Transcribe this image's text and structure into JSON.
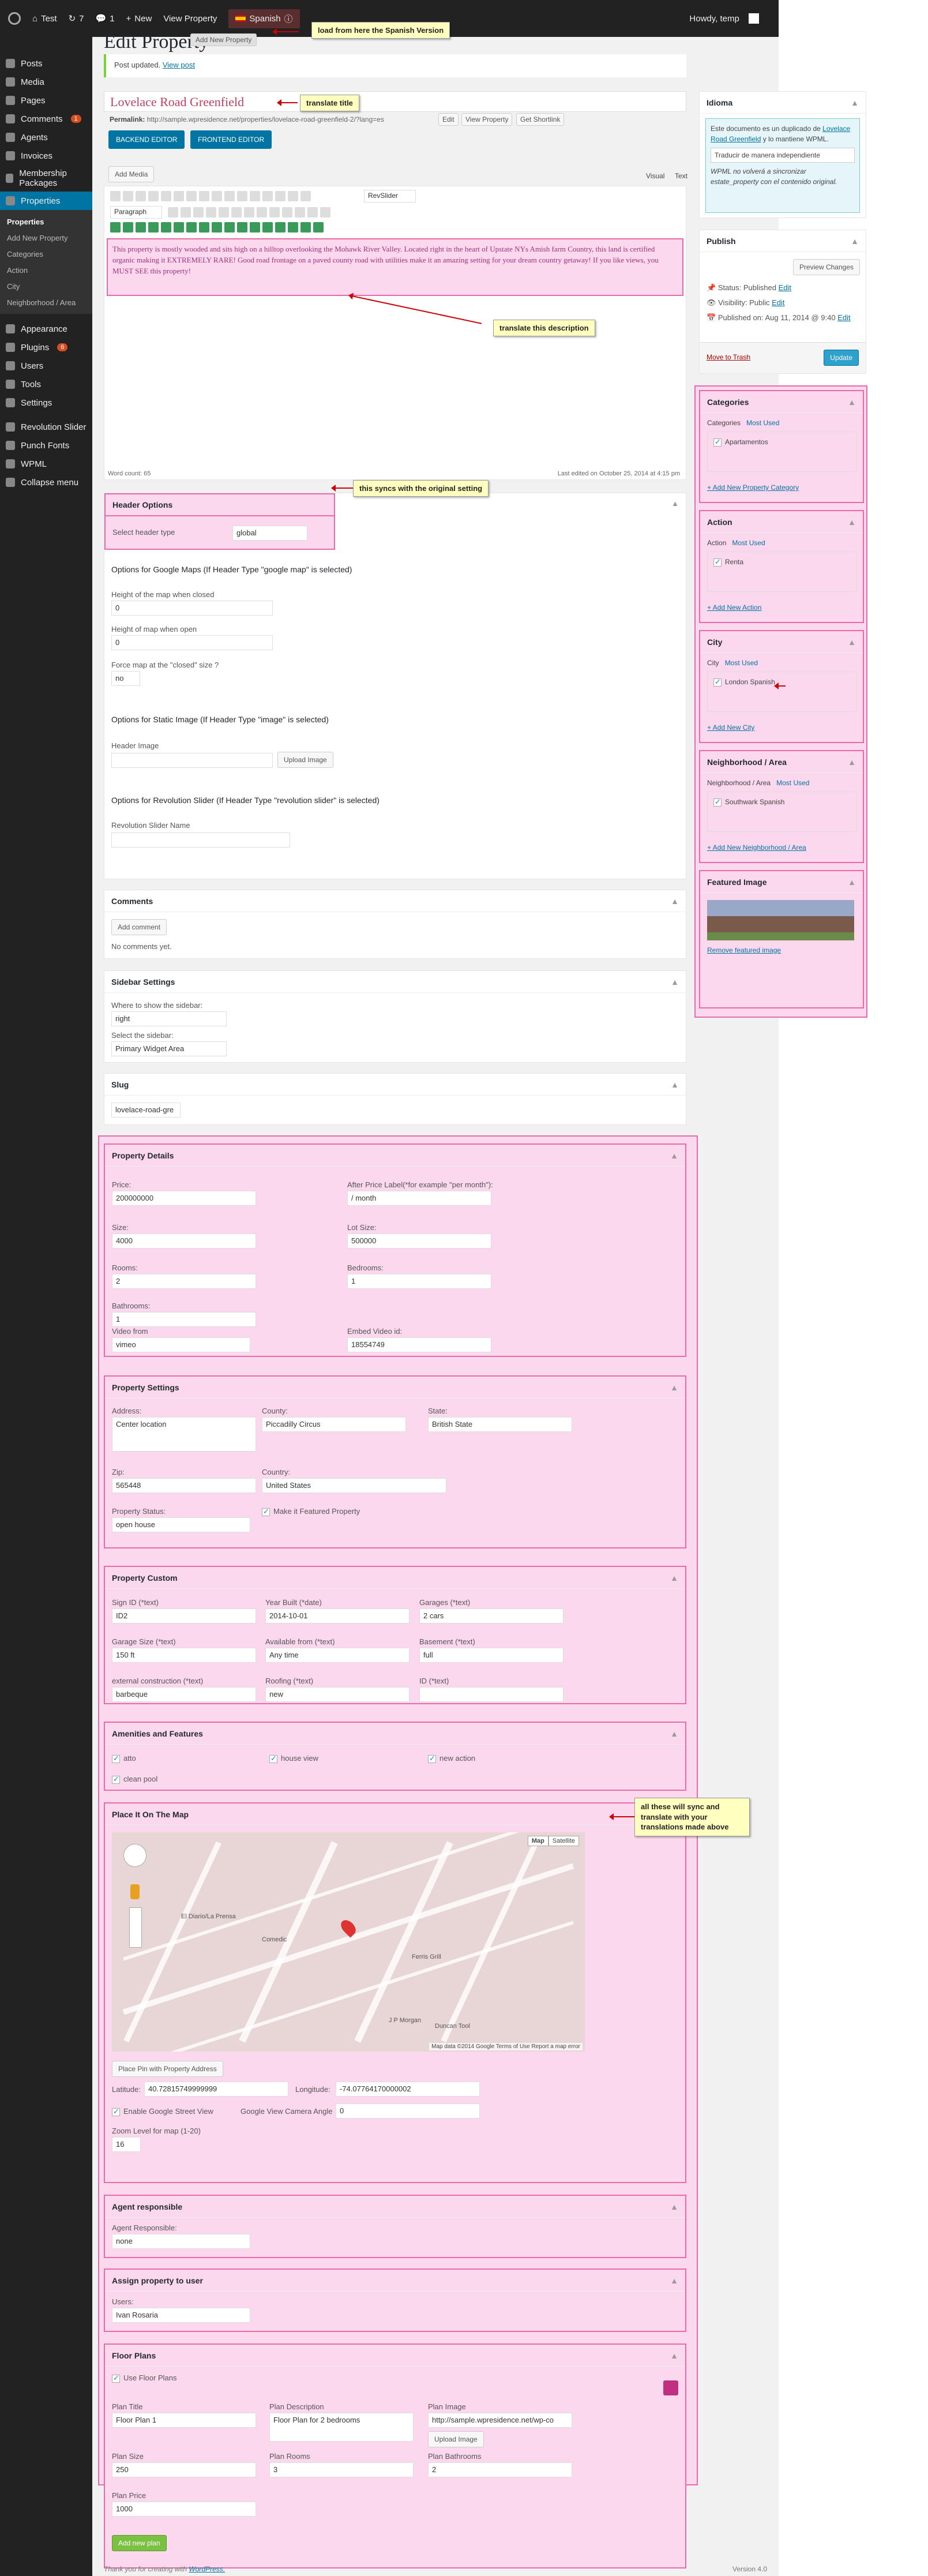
{
  "adminbar": {
    "site": "Test",
    "updates": "7",
    "comments": "1",
    "new": "New",
    "view": "View Property",
    "lang": "Spanish",
    "lang_flag": "spain-flag-icon",
    "howdy": "Howdy, temp"
  },
  "sidebar": {
    "items": [
      {
        "label": "Posts",
        "icon": "pin-icon"
      },
      {
        "label": "Media",
        "icon": "media-icon"
      },
      {
        "label": "Pages",
        "icon": "page-icon"
      },
      {
        "label": "Comments",
        "icon": "comment-icon",
        "badge": "1"
      },
      {
        "label": "Agents",
        "icon": "user-icon"
      },
      {
        "label": "Invoices",
        "icon": "invoice-icon"
      },
      {
        "label": "Membership Packages",
        "icon": "package-icon"
      },
      {
        "label": "Properties",
        "icon": "home-icon",
        "active": true
      }
    ],
    "sub": [
      "Properties",
      "Add New Property",
      "Categories",
      "Action",
      "City",
      "Neighborhood / Area"
    ],
    "items2": [
      {
        "label": "Appearance"
      },
      {
        "label": "Plugins",
        "badge": "6"
      },
      {
        "label": "Users"
      },
      {
        "label": "Tools"
      },
      {
        "label": "Settings"
      },
      {
        "label": "Revolution Slider"
      },
      {
        "label": "Punch Fonts"
      },
      {
        "label": "WPML"
      },
      {
        "label": "Collapse menu"
      }
    ]
  },
  "page": {
    "title": "Edit Property",
    "add_new": "Add New Property",
    "notice": "Post updated.",
    "notice_link": "View post"
  },
  "editor": {
    "post_title": "Lovelace Road Greenfield",
    "permalink_label": "Permalink:",
    "permalink": "http://sample.wpresidence.net/properties/lovelace-road-greenfield-2/?lang=es",
    "edit": "Edit",
    "view_property": "View Property",
    "get_shortlink": "Get Shortlink",
    "backend": "BACKEND EDITOR",
    "frontend": "FRONTEND EDITOR",
    "add_media": "Add Media",
    "visual": "Visual",
    "text": "Text",
    "paragraph": "Paragraph",
    "revslider": "RevSlider",
    "body": "This property is mostly wooded and sits high on a hilltop overlooking the Mohawk River Valley. Located right in the heart of Upstate NYs Amish farm Country, this land is certified organic making it EXTREMELY RARE! Good road frontage on a paved county road with utilities make it an amazing setting for your dream country getaway! If you like views, you MUST SEE this property!",
    "word_count": "Word count: 65",
    "last_edited": "Last edited on October 25, 2014 at 4:15 pm"
  },
  "header_options": {
    "title": "Header Options",
    "label": "Select header type",
    "value": "global"
  },
  "gmaps": {
    "title": "Options for Google Maps (If Header Type \"google map\" is selected)",
    "h_closed": "Height of the map when closed",
    "h_closed_val": "0",
    "h_open": "Height of map when open",
    "h_open_val": "0",
    "force": "Force map at the \"closed\" size ?",
    "force_val": "no"
  },
  "static_img": {
    "title": "Options for Static Image (If Header Type \"image\" is selected)",
    "label": "Header Image",
    "btn": "Upload Image"
  },
  "rev": {
    "title": "Options for Revolution Slider (If Header Type \"revolution slider\" is selected)",
    "label": "Revolution Slider Name"
  },
  "comments": {
    "title": "Comments",
    "btn": "Add comment",
    "none": "No comments yet."
  },
  "sidebar_settings": {
    "title": "Sidebar Settings",
    "where": "Where to show the sidebar:",
    "where_val": "right",
    "select": "Select the sidebar:",
    "select_val": "Primary Widget Area"
  },
  "slug": {
    "title": "Slug",
    "value": "lovelace-road-gre"
  },
  "details": {
    "title": "Property Details",
    "price": "Price:",
    "price_val": "200000000",
    "after": "After Price Label(*for example \"per month\"):",
    "after_val": "/ month",
    "size": "Size:",
    "size_val": "4000",
    "lot": "Lot Size:",
    "lot_val": "500000",
    "rooms": "Rooms:",
    "rooms_val": "2",
    "bedrooms": "Bedrooms:",
    "bedrooms_val": "1",
    "bathrooms": "Bathrooms:",
    "bathrooms_val": "1",
    "video": "Video from",
    "video_val": "vimeo",
    "embed": "Embed Video id:",
    "embed_val": "18554749"
  },
  "settings": {
    "title": "Property Settings",
    "address": "Address:",
    "address_val": "Center location",
    "county": "County:",
    "county_val": "Piccadilly Circus",
    "state": "State:",
    "state_val": "British State",
    "zip": "Zip:",
    "zip_val": "565448",
    "country": "Country:",
    "country_val": "United States",
    "status": "Property Status:",
    "status_val": "open house",
    "featured": "Make it Featured Property"
  },
  "custom": {
    "title": "Property Custom",
    "sign": "Sign ID (*text)",
    "sign_val": "ID2",
    "year": "Year Built (*date)",
    "year_val": "2014-10-01",
    "garages": "Garages (*text)",
    "garages_val": "2 cars",
    "gsize": "Garage Size (*text)",
    "gsize_val": "150 ft",
    "avail": "Available from (*text)",
    "avail_val": "Any time",
    "basement": "Basement (*text)",
    "basement_val": "full",
    "ext": "external construction (*text)",
    "ext_val": "barbeque",
    "roof": "Roofing (*text)",
    "roof_val": "new",
    "id": "ID (*text)",
    "id_val": ""
  },
  "amenities": {
    "title": "Amenities and Features",
    "items": [
      "atto",
      "house view",
      "new action",
      "clean pool"
    ]
  },
  "map": {
    "title": "Place It On The Map",
    "map_btn": "Map",
    "sat_btn": "Satellite",
    "pin_btn": "Place Pin with Property Address",
    "lat": "Latitude:",
    "lat_val": "40.72815749999999",
    "lng": "Longitude:",
    "lng_val": "-74.07764170000002",
    "street": "Enable Google Street View",
    "cam": "Google View Camera Angle",
    "cam_val": "0",
    "zoom": "Zoom Level for map (1-20)",
    "zoom_val": "16",
    "credits": "Map data ©2014 Google   Terms of Use   Report a map error",
    "labels": [
      "El Diario/La Prensa",
      "Comedic",
      "Duncan Tool",
      "J P Morgan",
      "Ferris Grill"
    ]
  },
  "agent": {
    "title": "Agent responsible",
    "label": "Agent Responsible:",
    "value": "none"
  },
  "assign": {
    "title": "Assign property to user",
    "label": "Users:",
    "value": "Ivan Rosaria"
  },
  "floor": {
    "title": "Floor Plans",
    "use": "Use Floor Plans",
    "plan_title": "Plan Title",
    "plan_title_val": "Floor Plan 1",
    "desc": "Plan Description",
    "desc_val": "Floor Plan for 2 bedrooms",
    "img": "Plan Image",
    "img_val": "http://sample.wpresidence.net/wp-co",
    "upload": "Upload Image",
    "psize": "Plan Size",
    "psize_val": "250",
    "prooms": "Plan Rooms",
    "prooms_val": "3",
    "pbath": "Plan Bathrooms",
    "pbath_val": "2",
    "price": "Plan Price",
    "price_val": "1000",
    "add": "Add new plan"
  },
  "idioma": {
    "title": "Idioma",
    "text1": "Este documento es un duplicado de",
    "link": "Lovelace Road Greenfield",
    "text2": "y lo mantiene WPML.",
    "btn": "Traducir de manera independiente",
    "note": "WPML no volverá a sincronizar estate_property con el contenido original."
  },
  "publish": {
    "title": "Publish",
    "preview": "Preview Changes",
    "status": "Status: Published",
    "vis": "Visibility: Public",
    "date": "Published on: Aug 11, 2014 @ 9:40",
    "edit": "Edit",
    "trash": "Move to Trash",
    "update": "Update"
  },
  "categories": {
    "title": "Categories",
    "tab1": "Categories",
    "tab2": "Most Used",
    "item": "Apartamentos",
    "add": "+ Add New Property Category"
  },
  "action": {
    "title": "Action",
    "tab1": "Action",
    "tab2": "Most Used",
    "item": "Renta",
    "add": "+ Add New Action"
  },
  "city": {
    "title": "City",
    "tab1": "City",
    "tab2": "Most Used",
    "item": "London Spanish",
    "add": "+ Add New City"
  },
  "neigh": {
    "title": "Neighborhood / Area",
    "tab1": "Neighborhood / Area",
    "tab2": "Most Used",
    "item": "Southwark Spanish",
    "add": "+ Add New Neighborhood / Area"
  },
  "featured": {
    "title": "Featured Image",
    "remove": "Remove featured image"
  },
  "annotations": {
    "a1": "load from here the Spanish Version",
    "a2": "translate title",
    "a3": "translate this description",
    "a4": "this syncs with the original setting",
    "a5": "all these will sync and translate with  your translations made above"
  },
  "footer": {
    "left": "Thank you for creating with",
    "left_link": "WordPress.",
    "right": "Version 4.0"
  }
}
